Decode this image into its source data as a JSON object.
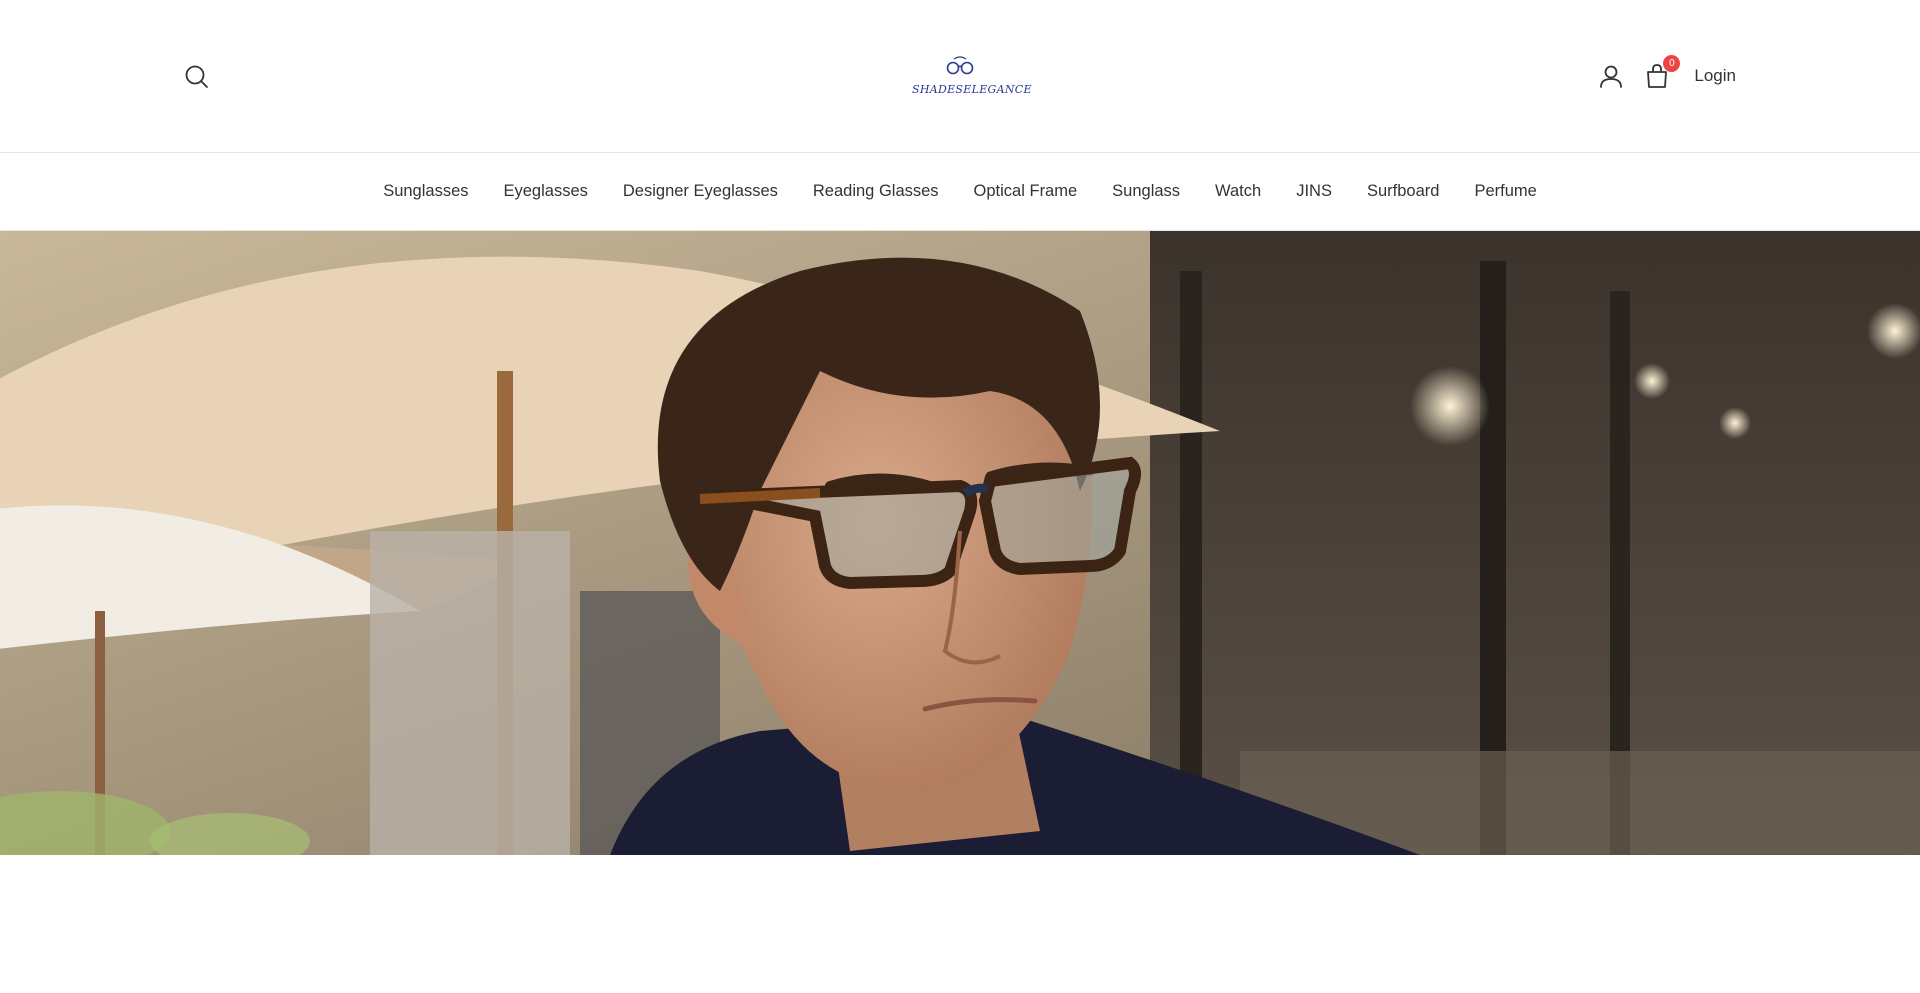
{
  "header": {
    "logo_text": "SHADESELEGANCE",
    "login_label": "Login",
    "cart_count": "0",
    "icons": [
      "search-icon",
      "user-icon",
      "cart-icon",
      "glasses-logo-icon"
    ]
  },
  "nav": {
    "items": [
      {
        "label": "Sunglasses"
      },
      {
        "label": "Eyeglasses"
      },
      {
        "label": "Designer Eyeglasses"
      },
      {
        "label": "Reading Glasses"
      },
      {
        "label": "Optical Frame"
      },
      {
        "label": "Sunglass"
      },
      {
        "label": "Watch"
      },
      {
        "label": "JINS"
      },
      {
        "label": "Surfboard"
      },
      {
        "label": "Perfume"
      }
    ]
  },
  "colors": {
    "text": "#333333",
    "badge": "#ef4444",
    "logo": "#2a3b8f",
    "border": "#e5e5e5"
  }
}
